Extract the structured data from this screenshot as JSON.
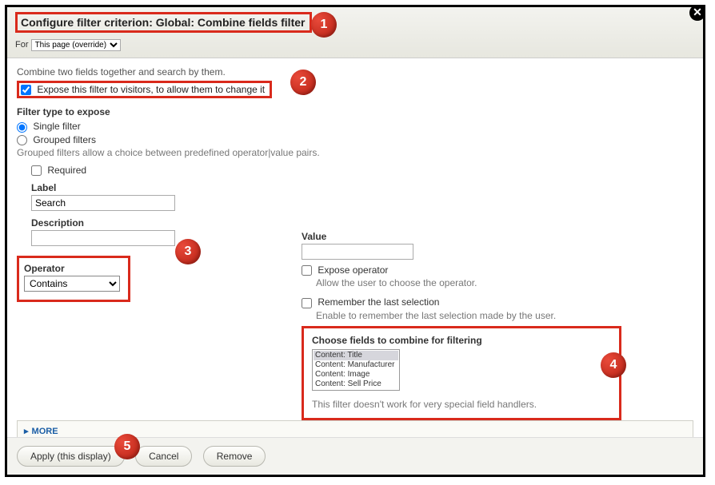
{
  "title": "Configure filter criterion: Global: Combine fields filter",
  "for_label": "For",
  "for_value": "This page (override)",
  "intro": "Combine two fields together and search by them.",
  "expose_label": "Expose this filter to visitors, to allow them to change it",
  "filter_type_heading": "Filter type to expose",
  "radio_single": "Single filter",
  "radio_grouped": "Grouped filters",
  "grouped_help": "Grouped filters allow a choice between predefined operator|value pairs.",
  "required_label": "Required",
  "label_label": "Label",
  "label_value": "Search",
  "description_label": "Description",
  "operator_label": "Operator",
  "operator_value": "Contains",
  "value_label": "Value",
  "expose_operator_label": "Expose operator",
  "expose_operator_help": "Allow the user to choose the operator.",
  "remember_label": "Remember the last selection",
  "remember_help": "Enable to remember the last selection made by the user.",
  "choose_heading": "Choose fields to combine for filtering",
  "choose_options": [
    "Content: Title",
    "Content: Manufacturer",
    "Content: Image",
    "Content: Sell Price"
  ],
  "choose_help": "This filter doesn't work for very special field handlers.",
  "more_label": "MORE",
  "btn_apply": "Apply (this display)",
  "btn_cancel": "Cancel",
  "btn_remove": "Remove",
  "badges": {
    "1": "1",
    "2": "2",
    "3": "3",
    "4": "4",
    "5": "5"
  }
}
